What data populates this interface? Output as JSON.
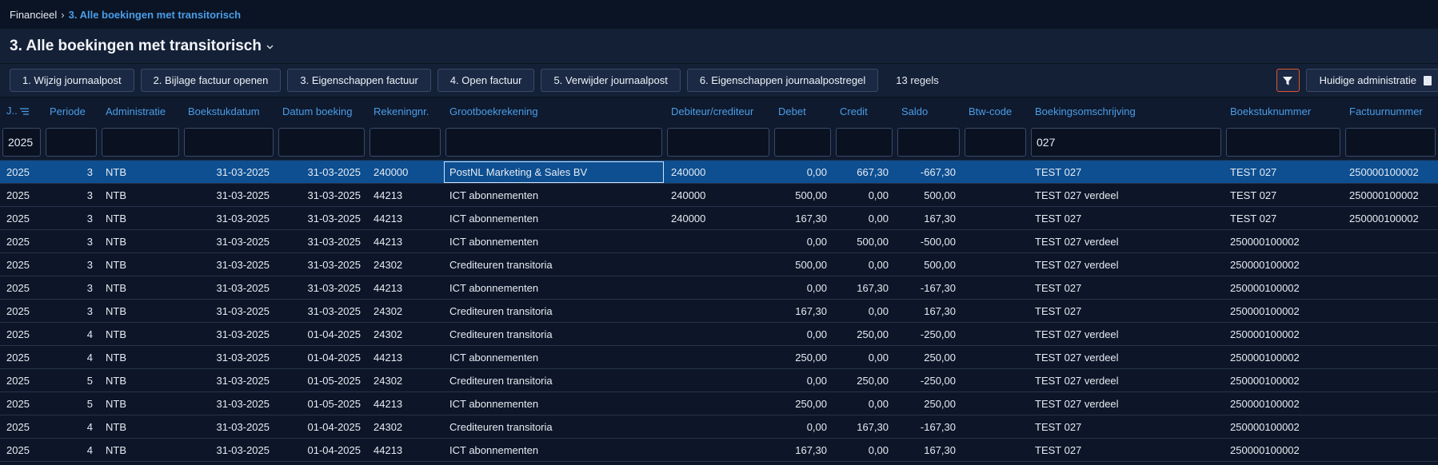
{
  "breadcrumb": {
    "root": "Financieel",
    "separator": "›",
    "current": "3. Alle boekingen met transitorisch"
  },
  "title": "3. Alle boekingen met transitorisch",
  "toolbar": {
    "buttons": [
      "1. Wijzig journaalpost",
      "2. Bijlage factuur openen",
      "3. Eigenschappen factuur",
      "4. Open factuur",
      "5. Verwijder journaalpost",
      "6. Eigenschappen journaalpostregel"
    ],
    "row_count": "13 regels",
    "admin_button": "Huidige administratie"
  },
  "colors": {
    "accent": "#4a9de8",
    "selected_row": "#0d4f91",
    "filter_border": "#e0572f"
  },
  "table": {
    "headers": [
      "J..",
      "Periode",
      "Administratie",
      "Boekstukdatum",
      "Datum boeking",
      "Rekeningnr.",
      "Grootboekrekening",
      "Debiteur/crediteur",
      "Debet",
      "Credit",
      "Saldo",
      "Btw-code",
      "Boekingsomschrijving",
      "Boekstuknummer",
      "Factuurnummer"
    ],
    "filters": [
      "2025",
      "",
      "",
      "",
      "",
      "",
      "",
      "",
      "",
      "",
      "",
      "",
      "027",
      "",
      ""
    ],
    "rows": [
      [
        "2025",
        "3",
        "NTB",
        "31-03-2025",
        "31-03-2025",
        "240000",
        "PostNL Marketing & Sales BV",
        "240000",
        "0,00",
        "667,30",
        "-667,30",
        "",
        "TEST 027",
        "TEST 027",
        "250000100002"
      ],
      [
        "2025",
        "3",
        "NTB",
        "31-03-2025",
        "31-03-2025",
        "44213",
        "ICT abonnementen",
        "240000",
        "500,00",
        "0,00",
        "500,00",
        "",
        "TEST 027 verdeel",
        "TEST 027",
        "250000100002"
      ],
      [
        "2025",
        "3",
        "NTB",
        "31-03-2025",
        "31-03-2025",
        "44213",
        "ICT abonnementen",
        "240000",
        "167,30",
        "0,00",
        "167,30",
        "",
        "TEST 027",
        "TEST 027",
        "250000100002"
      ],
      [
        "2025",
        "3",
        "NTB",
        "31-03-2025",
        "31-03-2025",
        "44213",
        "ICT abonnementen",
        "",
        "0,00",
        "500,00",
        "-500,00",
        "",
        "TEST 027 verdeel",
        "250000100002",
        ""
      ],
      [
        "2025",
        "3",
        "NTB",
        "31-03-2025",
        "31-03-2025",
        "24302",
        "Crediteuren transitoria",
        "",
        "500,00",
        "0,00",
        "500,00",
        "",
        "TEST 027 verdeel",
        "250000100002",
        ""
      ],
      [
        "2025",
        "3",
        "NTB",
        "31-03-2025",
        "31-03-2025",
        "44213",
        "ICT abonnementen",
        "",
        "0,00",
        "167,30",
        "-167,30",
        "",
        "TEST 027",
        "250000100002",
        ""
      ],
      [
        "2025",
        "3",
        "NTB",
        "31-03-2025",
        "31-03-2025",
        "24302",
        "Crediteuren transitoria",
        "",
        "167,30",
        "0,00",
        "167,30",
        "",
        "TEST 027",
        "250000100002",
        ""
      ],
      [
        "2025",
        "4",
        "NTB",
        "31-03-2025",
        "01-04-2025",
        "24302",
        "Crediteuren transitoria",
        "",
        "0,00",
        "250,00",
        "-250,00",
        "",
        "TEST 027 verdeel",
        "250000100002",
        ""
      ],
      [
        "2025",
        "4",
        "NTB",
        "31-03-2025",
        "01-04-2025",
        "44213",
        "ICT abonnementen",
        "",
        "250,00",
        "0,00",
        "250,00",
        "",
        "TEST 027 verdeel",
        "250000100002",
        ""
      ],
      [
        "2025",
        "5",
        "NTB",
        "31-03-2025",
        "01-05-2025",
        "24302",
        "Crediteuren transitoria",
        "",
        "0,00",
        "250,00",
        "-250,00",
        "",
        "TEST 027 verdeel",
        "250000100002",
        ""
      ],
      [
        "2025",
        "5",
        "NTB",
        "31-03-2025",
        "01-05-2025",
        "44213",
        "ICT abonnementen",
        "",
        "250,00",
        "0,00",
        "250,00",
        "",
        "TEST 027 verdeel",
        "250000100002",
        ""
      ],
      [
        "2025",
        "4",
        "NTB",
        "31-03-2025",
        "01-04-2025",
        "24302",
        "Crediteuren transitoria",
        "",
        "0,00",
        "167,30",
        "-167,30",
        "",
        "TEST 027",
        "250000100002",
        ""
      ],
      [
        "2025",
        "4",
        "NTB",
        "31-03-2025",
        "01-04-2025",
        "44213",
        "ICT abonnementen",
        "",
        "167,30",
        "0,00",
        "167,30",
        "",
        "TEST 027",
        "250000100002",
        ""
      ]
    ]
  }
}
